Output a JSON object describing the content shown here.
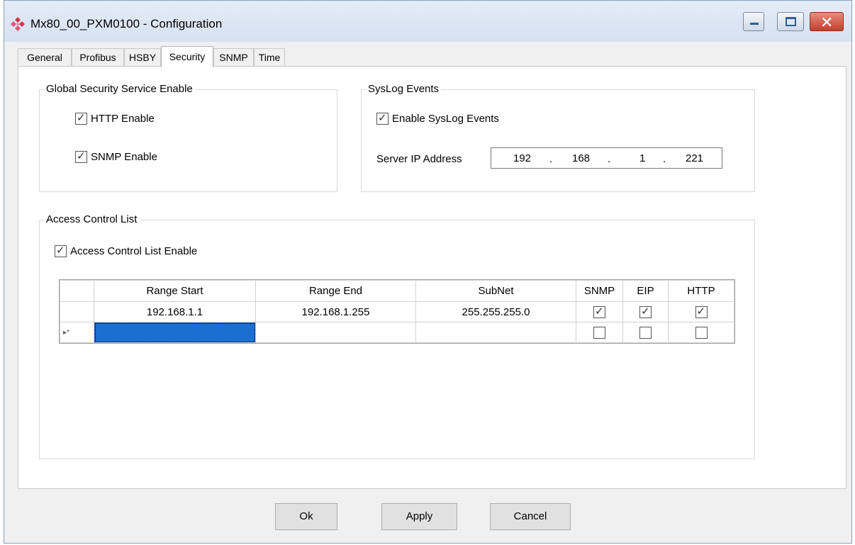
{
  "window": {
    "title": "Mx80_00_PXM0100 - Configuration",
    "close_glyph": "✕"
  },
  "tabs": [
    {
      "label": "General"
    },
    {
      "label": "Profibus"
    },
    {
      "label": "HSBY"
    },
    {
      "label": "Security",
      "active": true
    },
    {
      "label": "SNMP"
    },
    {
      "label": "Time"
    }
  ],
  "global_security": {
    "legend": "Global Security Service Enable",
    "http_enable": {
      "label": "HTTP Enable",
      "checked": true
    },
    "snmp_enable": {
      "label": "SNMP Enable",
      "checked": true
    }
  },
  "syslog": {
    "legend": "SysLog Events",
    "enable": {
      "label": "Enable SysLog Events",
      "checked": true
    },
    "server_ip_label": "Server IP Address",
    "server_ip": [
      "192",
      "168",
      "1",
      "221"
    ],
    "ip_separator": "."
  },
  "acl": {
    "legend": "Access Control List",
    "enable": {
      "label": "Access Control List Enable",
      "checked": true
    },
    "columns": [
      "Range Start",
      "Range End",
      "SubNet",
      "SNMP",
      "EIP",
      "HTTP"
    ],
    "rows": [
      {
        "range_start": "192.168.1.1",
        "range_end": "192.168.1.255",
        "subnet": "255.255.255.0",
        "snmp": true,
        "eip": true,
        "http": true
      }
    ],
    "new_row_marker": "▸*"
  },
  "buttons": {
    "ok": "Ok",
    "apply": "Apply",
    "cancel": "Cancel"
  },
  "colors": {
    "selected_cell": "#1b6fd1",
    "title_bar": "#dae5f2",
    "close_button": "#c94a36"
  },
  "icons": {
    "app": "diamond-cluster-icon",
    "check": "✓"
  }
}
